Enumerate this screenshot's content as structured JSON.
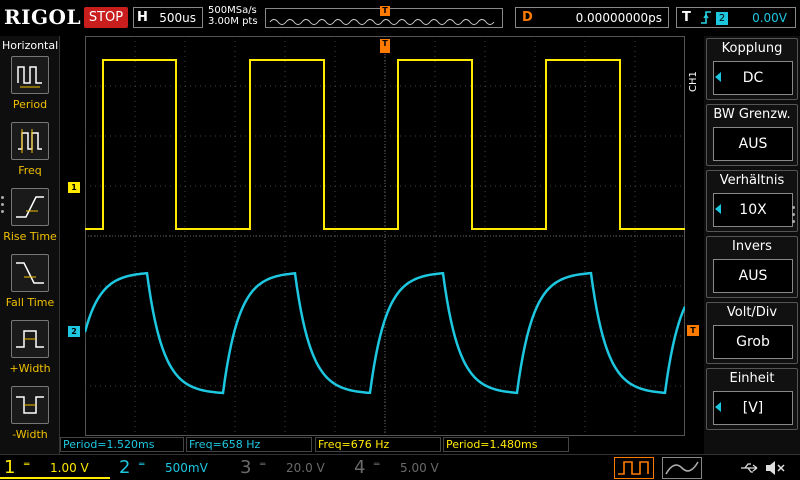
{
  "brand": {
    "logo": "RIGOL"
  },
  "run_state": {
    "label": "STOP",
    "color": "#c81e1e"
  },
  "horizontal": {
    "label": "H",
    "timebase": "500us"
  },
  "sampling": {
    "rate": "500MSa/s",
    "points": "3.00M pts"
  },
  "delay": {
    "label": "D",
    "value": "0.00000000ps"
  },
  "trigger": {
    "label": "T",
    "edge_icon": "rising-edge-icon",
    "source": "2",
    "level": "0.00V"
  },
  "left_menu": {
    "title": "Horizontal",
    "items": [
      {
        "label": "Period",
        "icon": "period-icon"
      },
      {
        "label": "Freq",
        "icon": "freq-icon"
      },
      {
        "label": "Rise Time",
        "icon": "rise-time-icon"
      },
      {
        "label": "Fall Time",
        "icon": "fall-time-icon"
      },
      {
        "label": "+Width",
        "icon": "pos-width-icon"
      },
      {
        "label": "-Width",
        "icon": "neg-width-icon"
      }
    ]
  },
  "right_menu": {
    "channel_tag": "CH1",
    "items": [
      {
        "title": "Kopplung",
        "value": "DC",
        "has_arrow": true
      },
      {
        "title": "BW Grenzw.",
        "value": "AUS",
        "has_arrow": false
      },
      {
        "title": "Verhältnis",
        "value": "10X",
        "has_arrow": true
      },
      {
        "title": "Invers",
        "value": "AUS",
        "has_arrow": false
      },
      {
        "title": "Volt/Div",
        "value": "Grob",
        "has_arrow": false
      },
      {
        "title": "Einheit",
        "value": "[V]",
        "has_arrow": true
      }
    ]
  },
  "markers": {
    "ch1": "1",
    "ch2": "2",
    "trigger": "T"
  },
  "measurements": [
    {
      "text": "Period=1.520ms"
    },
    {
      "text": "Freq=658 Hz"
    },
    {
      "text": "Freq=676 Hz"
    },
    {
      "text": "Period=1.480ms"
    }
  ],
  "channels": [
    {
      "num": "1",
      "scale": "1.00 V",
      "color": "#ffea00",
      "active": true
    },
    {
      "num": "2",
      "scale": "500mV",
      "color": "#1ec7e0",
      "active": true
    },
    {
      "num": "3",
      "scale": "20.0 V",
      "color": "#6a6a6a",
      "active": false
    },
    {
      "num": "4",
      "scale": "5.00 V",
      "color": "#6a6a6a",
      "active": false
    }
  ],
  "waveforms": {
    "ch1": {
      "color": "#ffea00",
      "type": "square"
    },
    "ch2": {
      "color": "#1ec7e0",
      "type": "rc-charge"
    }
  },
  "status_icons": [
    "usb-icon",
    "speaker-mute-icon"
  ]
}
